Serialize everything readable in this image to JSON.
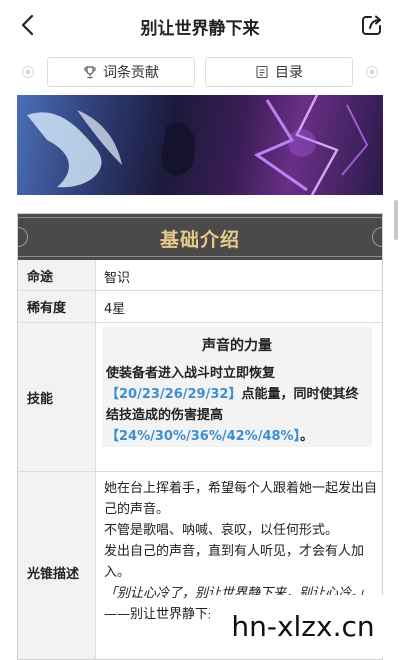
{
  "nav": {
    "title": "别让世界静下来"
  },
  "actions": {
    "contribute_label": "词条贡献",
    "toc_label": "目录"
  },
  "card": {
    "title": "基础介绍",
    "rows": {
      "path": {
        "label": "命途",
        "value": "智识"
      },
      "rarity": {
        "label": "稀有度",
        "value": "4星"
      },
      "skill": {
        "label": "技能",
        "name": "声音的力量",
        "desc_1": "使装备者进入战斗时立即恢复",
        "hl_1": "【20/23/26/29/32】",
        "desc_2": "点能量，同时使其终结技造成的伤害提高",
        "hl_2": "【24%/30%/36%/42%/48%】",
        "desc_3": "。"
      },
      "description": {
        "label": "光锥描述",
        "lines": [
          "她在台上挥着手，希望每个人跟着她一起发出自己的声音。",
          "不管是歌唱、呐喊、哀叹，以任何形式。",
          "发出自己的声音，直到有人听见，才会有人加入。",
          "「别让心冷了，别让世界静下来，别让心冷。」",
          "——别让世界静下来"
        ]
      }
    }
  },
  "watermark": "hn-xlzx.cn"
}
